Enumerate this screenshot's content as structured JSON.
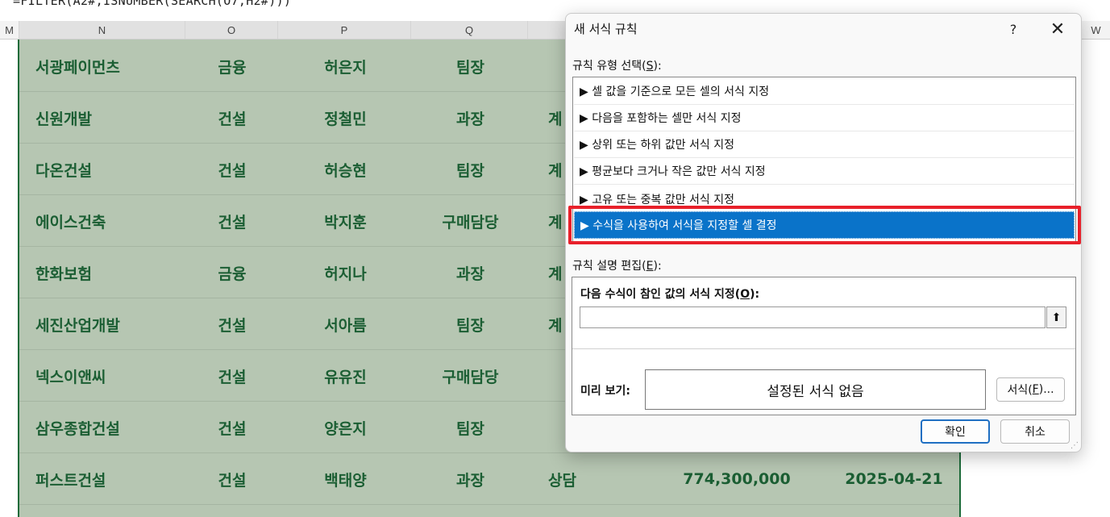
{
  "formula_bar": {
    "text": "=FILTER(A2#,ISNUMBER(SEARCH(O7,H2#)))"
  },
  "column_headers": [
    "M",
    "N",
    "O",
    "P",
    "Q",
    "W"
  ],
  "rows": [
    {
      "company": "서광페이먼츠",
      "industry": "금융",
      "name": "허은지",
      "title": "팀장",
      "status": "",
      "amount": "",
      "date": ""
    },
    {
      "company": "신원개발",
      "industry": "건설",
      "name": "정철민",
      "title": "과장",
      "status": "계",
      "amount": "",
      "date": ""
    },
    {
      "company": "다온건설",
      "industry": "건설",
      "name": "허승현",
      "title": "팀장",
      "status": "계",
      "amount": "",
      "date": ""
    },
    {
      "company": "에이스건축",
      "industry": "건설",
      "name": "박지훈",
      "title": "구매담당",
      "status": "계",
      "amount": "",
      "date": ""
    },
    {
      "company": "한화보험",
      "industry": "금융",
      "name": "허지나",
      "title": "과장",
      "status": "계",
      "amount": "",
      "date": ""
    },
    {
      "company": "세진산업개발",
      "industry": "건설",
      "name": "서아름",
      "title": "팀장",
      "status": "계",
      "amount": "",
      "date": ""
    },
    {
      "company": "넥스이앤씨",
      "industry": "건설",
      "name": "유유진",
      "title": "구매담당",
      "status": "",
      "amount": "",
      "date": ""
    },
    {
      "company": "삼우종합건설",
      "industry": "건설",
      "name": "양은지",
      "title": "팀장",
      "status": "",
      "amount": "",
      "date": ""
    },
    {
      "company": "퍼스트건설",
      "industry": "건설",
      "name": "백태양",
      "title": "과장",
      "status": "상담",
      "amount": "774,300,000",
      "date": "2025-04-21"
    }
  ],
  "dialog": {
    "title": "새 서식 규칙",
    "help": "?",
    "close": "✕",
    "rule_type_label": "규칙 유형 선택(",
    "rule_type_key": "S",
    "rule_type_suffix": "):",
    "rules": [
      "▶ 셀 값을 기준으로 모든 셀의 서식 지정",
      "▶ 다음을 포함하는 셀만 서식 지정",
      "▶ 상위 또는 하위 값만 서식 지정",
      "▶ 평균보다 크거나 작은 값만 서식 지정",
      "▶ 고유 또는 중복 값만 서식 지정",
      "▶ 수식을 사용하여 서식을 지정할 셀 결정"
    ],
    "selected_rule_index": 5,
    "desc_label": "규칙 설명 편집(",
    "desc_key": "E",
    "desc_suffix": "):",
    "formula_title": "다음 수식이 참인 값의 서식 지정(",
    "formula_key": "O",
    "formula_suffix": "):",
    "formula_value": "",
    "collapse_icon": "⬆",
    "preview_label": "미리 보기:",
    "preview_text": "설정된 서식 없음",
    "format_button": "서식(",
    "format_key": "F",
    "format_suffix": ")...",
    "ok": "확인",
    "cancel": "취소"
  },
  "colors": {
    "selected_row": "#0a73c9",
    "highlight": "#e8202a",
    "sheet_fill": "#b6c6b2",
    "sheet_text": "#1b5e33"
  }
}
